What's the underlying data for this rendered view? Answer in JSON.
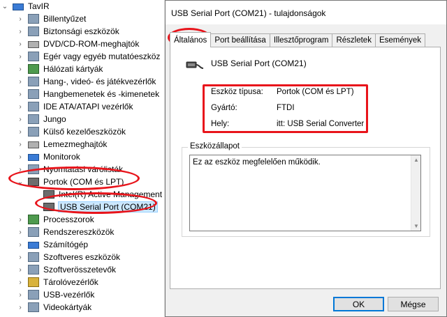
{
  "tree": {
    "root": "TavIR",
    "categories": [
      "Billentyűzet",
      "Biztonsági eszközök",
      "DVD/CD-ROM-meghajtók",
      "Egér vagy egyéb mutatóeszköz",
      "Hálózati kártyák",
      "Hang-, videó- és játékvezérlők",
      "Hangbemenetek és -kimenetek",
      "IDE ATA/ATAPI vezérlők",
      "Jungo",
      "Külső kezelőeszközök",
      "Lemezmeghajtók",
      "Monitorok",
      "Nyomtatási várólisták"
    ],
    "ports": {
      "label": "Portok (COM és LPT)",
      "child1": "Intel(R) Active Management Te",
      "child2": "USB Serial Port (COM21)"
    },
    "categories_after": [
      "Processzorok",
      "Rendszereszközök",
      "Számítógép",
      "Szoftveres eszközök",
      "Szoftverösszetevők",
      "Tárolóvezérlők",
      "USB-vezérlők",
      "Videokártyák"
    ]
  },
  "dialog": {
    "title": "USB Serial Port (COM21) - tulajdonságok",
    "tabs": [
      "Általános",
      "Port beállítása",
      "Illesztőprogram",
      "Részletek",
      "Események"
    ],
    "device_name": "USB Serial Port (COM21)",
    "properties": [
      {
        "label": "Eszköz típusa:",
        "value": "Portok (COM és LPT)"
      },
      {
        "label": "Gyártó:",
        "value": "FTDI"
      },
      {
        "label": "Hely:",
        "value": "itt: USB Serial Converter"
      }
    ],
    "status_legend": "Eszközállapot",
    "status_text": "Ez az eszköz megfelelően működik.",
    "ok_label": "OK",
    "cancel_label": "Mégse"
  },
  "colors": {
    "annotation": "#e8141b",
    "selection": "#cce8ff",
    "accent": "#0078d7"
  }
}
